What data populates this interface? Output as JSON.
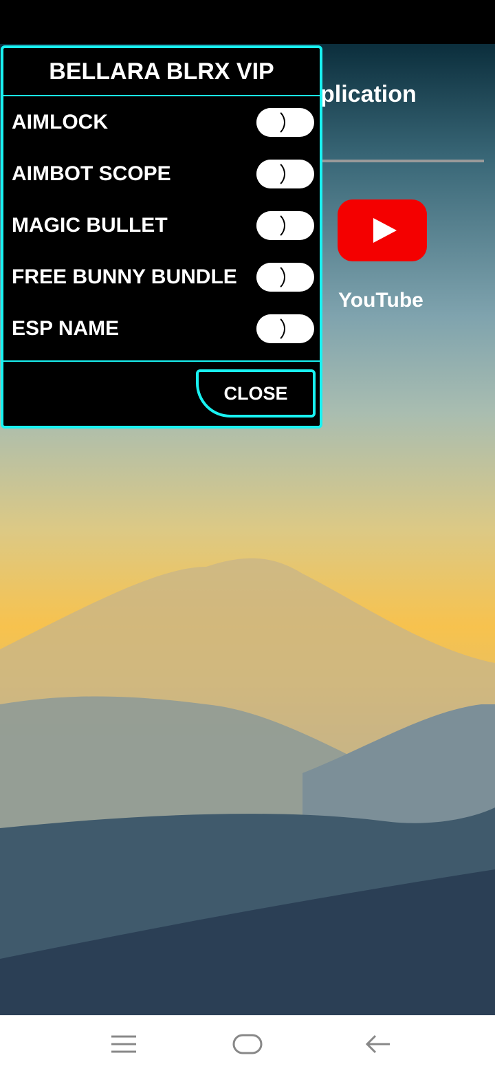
{
  "background": {
    "app_title_partial": "plication",
    "apps": [
      {
        "label": "YouTube",
        "icon": "youtube-icon",
        "color": "#f40000"
      }
    ]
  },
  "panel": {
    "title": "BELLARA BLRX VIP",
    "accent": "#19f2f2",
    "items": [
      {
        "label": "AIMLOCK",
        "on": false
      },
      {
        "label": "AIMBOT SCOPE",
        "on": false
      },
      {
        "label": "MAGIC BULLET",
        "on": false
      },
      {
        "label": "FREE BUNNY BUNDLE",
        "on": false
      },
      {
        "label": "ESP NAME",
        "on": false
      }
    ],
    "close_label": "CLOSE"
  },
  "navbar": {
    "icons": [
      "menu-icon",
      "home-icon",
      "back-icon"
    ]
  }
}
